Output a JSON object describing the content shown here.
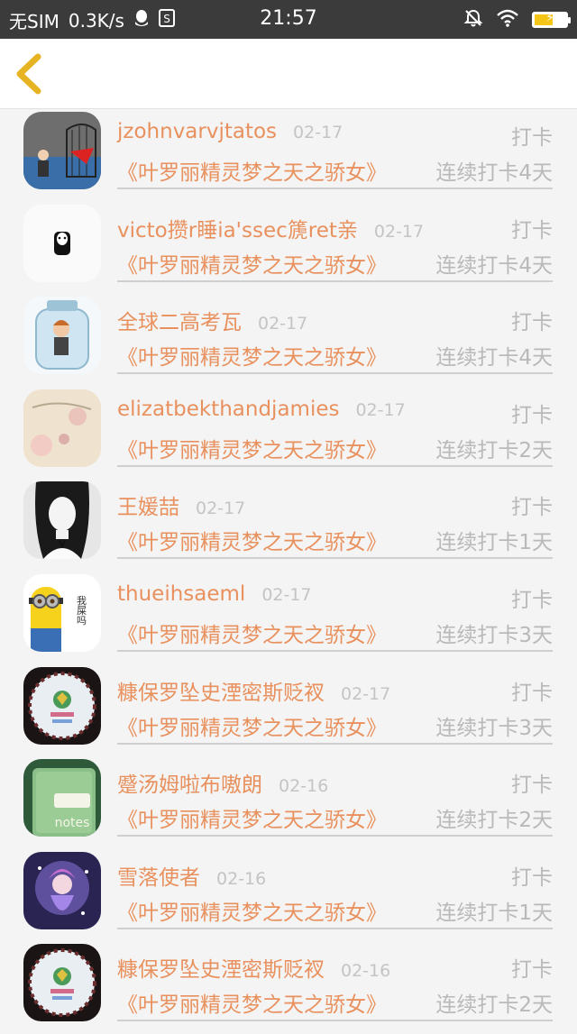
{
  "status_bar": {
    "carrier": "无SIM",
    "speed": "0.3K/s",
    "time": "21:57",
    "icons": [
      "qq-icon",
      "sim-card-icon",
      "bell-off-icon",
      "wifi-icon",
      "battery-charging-icon"
    ]
  },
  "nav": {
    "back_icon": "chevron-left-icon",
    "accent": "#e6b422"
  },
  "colors": {
    "name": "#e9915e",
    "muted": "#b9b9b9",
    "date": "#c4c4c4",
    "background": "#f4f4f4"
  },
  "entries": [
    {
      "name": "jzohnvarvjtatos",
      "date": "02-17",
      "action": "打卡",
      "book": "《叶罗丽精灵梦之天之骄女》",
      "streak": "连续打卡4天"
    },
    {
      "name": "victo攒r睡ia'ssec篪ret亲",
      "date": "02-17",
      "action": "打卡",
      "book": "《叶罗丽精灵梦之天之骄女》",
      "streak": "连续打卡4天"
    },
    {
      "name": "全球二高考瓦",
      "date": "02-17",
      "action": "打卡",
      "book": "《叶罗丽精灵梦之天之骄女》",
      "streak": "连续打卡4天"
    },
    {
      "name": "elizatbekthandjamies",
      "date": "02-17",
      "action": "打卡",
      "book": "《叶罗丽精灵梦之天之骄女》",
      "streak": "连续打卡2天"
    },
    {
      "name": "王媛喆",
      "date": "02-17",
      "action": "打卡",
      "book": "《叶罗丽精灵梦之天之骄女》",
      "streak": "连续打卡1天"
    },
    {
      "name": "thueihsaeml",
      "date": "02-17",
      "action": "打卡",
      "book": "《叶罗丽精灵梦之天之骄女》",
      "streak": "连续打卡3天"
    },
    {
      "name": "糠保罗坠史湮密斯贬衩",
      "date": "02-17",
      "action": "打卡",
      "book": "《叶罗丽精灵梦之天之骄女》",
      "streak": "连续打卡3天"
    },
    {
      "name": "蹙汤姆啦布嗷朗",
      "date": "02-16",
      "action": "打卡",
      "book": "《叶罗丽精灵梦之天之骄女》",
      "streak": "连续打卡2天"
    },
    {
      "name": "雪落使者",
      "date": "02-16",
      "action": "打卡",
      "book": "《叶罗丽精灵梦之天之骄女》",
      "streak": "连续打卡1天"
    },
    {
      "name": "糠保罗坠史湮密斯贬衩",
      "date": "02-16",
      "action": "打卡",
      "book": "《叶罗丽精灵梦之天之骄女》",
      "streak": "连续打卡2天"
    }
  ],
  "minion_text": "我屎吗",
  "notes_text": "notes"
}
